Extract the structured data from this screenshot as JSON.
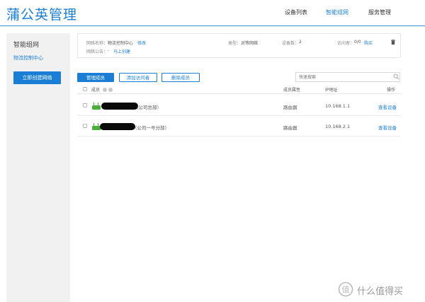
{
  "header": {
    "title": "蒲公英管理",
    "nav": [
      {
        "label": "设备列表"
      },
      {
        "label": "智能组网"
      },
      {
        "label": "服务管理"
      }
    ]
  },
  "sidebar": {
    "title": "智能组网",
    "sub": "物流控制中心",
    "create_btn": "立即创建网络"
  },
  "info": {
    "name_label": "网络名称：",
    "name_value": "物流控制中心",
    "modify": "修改",
    "notice_label": "网络公告：",
    "notice_value": "-",
    "build_now": "马上创建",
    "type_label": "类型：",
    "type_value": "对等网络",
    "count_label": "设备数：",
    "count_value": "2",
    "visitor_label": "访问者：",
    "visitor_value": "0/0",
    "buy": "购买"
  },
  "toolbar": {
    "manage": "管理成员",
    "add_visitor": "添加访问者",
    "remove": "删除成员",
    "search_placeholder": "快速搜索"
  },
  "table": {
    "columns": [
      "成员",
      "成员属性",
      "IP地址",
      "操作"
    ],
    "rows": [
      {
        "name_suffix": "（公司总部）",
        "attr": "路由器",
        "ip": "10.168.1.1",
        "action": "查看设备"
      },
      {
        "name_suffix": "（公司一号分部）",
        "attr": "路由器",
        "ip": "10.168.2.1",
        "action": "查看设备"
      }
    ]
  },
  "watermark": {
    "text": "什么值得买"
  }
}
